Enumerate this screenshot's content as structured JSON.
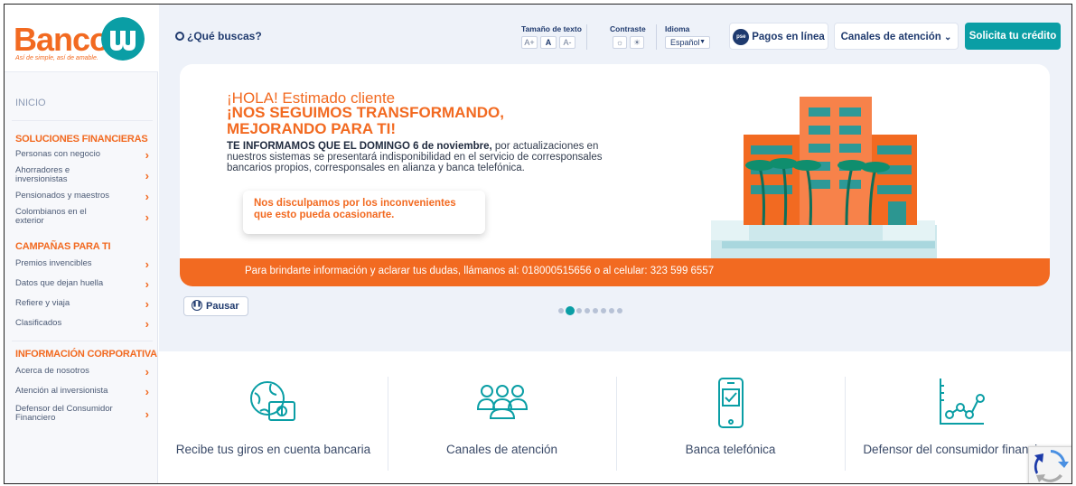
{
  "brand": {
    "name": "Banco",
    "mark": "W",
    "tagline": "Así de simple, así de amable.",
    "colors": {
      "primary": "#f26a21",
      "accent": "#0a9ea5",
      "navy": "#1f3a6e"
    }
  },
  "sidebar": {
    "home": "INICIO",
    "sections": [
      {
        "title": "SOLUCIONES FINANCIERAS",
        "items": [
          "Personas con negocio",
          "Ahorradores e inversionistas",
          "Pensionados y maestros",
          "Colombianos en el exterior"
        ]
      },
      {
        "title": "CAMPAÑAS PARA TI",
        "items": [
          "Premios invencibles",
          "Datos que dejan huella",
          "Refiere y viaja",
          "Clasificados"
        ]
      },
      {
        "title": "INFORMACIÓN CORPORATIVA",
        "items": [
          "Acerca de nosotros",
          "Atención al inversionista",
          "Defensor del Consumidor Financiero"
        ]
      }
    ]
  },
  "topbar": {
    "search_label": "¿Qué buscas?",
    "text_size": {
      "label": "Tamaño de texto",
      "buttons": [
        "A+",
        "A",
        "A-"
      ]
    },
    "contrast": {
      "label": "Contraste",
      "buttons": [
        "☼",
        "☀"
      ]
    },
    "language": {
      "label": "Idioma",
      "value": "Español"
    },
    "pse_badge": "pse",
    "payments_button": "Pagos en línea",
    "channels_button": "Canales de atención",
    "credit_button": "Solicita tu crédito"
  },
  "banner": {
    "greeting": "¡HOLA! Estimado cliente",
    "headline": "¡NOS SEGUIMOS TRANSFORMANDO, MEJORANDO PARA TI!",
    "body_bold": "TE INFORMAMOS QUE EL DOMINGO 6 de noviembre,",
    "body_rest": " por actualizaciones en nuestros sistemas se presentará indisponibilidad en el servicio de corresponsales bancarios propios, corresponsales en alianza y banca telefónica.",
    "apology": "Nos disculpamos por los inconvenientes que esto pueda ocasionarte.",
    "contact_strip": "Para brindarte información y aclarar tus dudas, llámanos al: 018000515656 o al celular: 323 599 6557"
  },
  "carousel": {
    "pause_label": "Pausar",
    "slides_total": 8,
    "active_index": 1
  },
  "services": [
    {
      "label": "Recibe tus giros en cuenta bancaria",
      "icon": "globe-money-icon"
    },
    {
      "label": "Canales de atención",
      "icon": "people-group-icon"
    },
    {
      "label": "Banca telefónica",
      "icon": "smartphone-check-icon"
    },
    {
      "label": "Defensor del consumidor financiero",
      "icon": "line-chart-icon"
    }
  ]
}
